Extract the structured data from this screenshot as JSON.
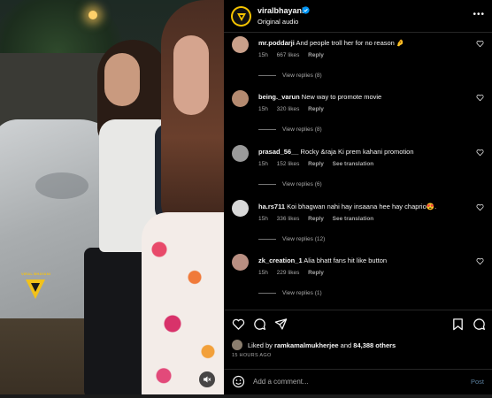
{
  "header": {
    "username": "viralbhayani",
    "audio": "Original audio",
    "brand_color": "#f5c400"
  },
  "media": {
    "watermark_text": "VIRAL BHAYANI"
  },
  "comments": [
    {
      "user": "mr.poddarji",
      "text": "And people troll her for no reason 🤌",
      "time": "15h",
      "likes": "667 likes",
      "reply": "Reply",
      "translate": "",
      "view_replies": "View replies (8)",
      "avatar_color": "#c9a08a"
    },
    {
      "user": "being._varun",
      "text": "New way to promote movie",
      "time": "15h",
      "likes": "320 likes",
      "reply": "Reply",
      "translate": "",
      "view_replies": "View replies (8)",
      "avatar_color": "#b48a70"
    },
    {
      "user": "prasad_56__",
      "text": "Rocky &raja Ki prem kahani promotion",
      "time": "15h",
      "likes": "152 likes",
      "reply": "Reply",
      "translate": "See translation",
      "view_replies": "View replies (6)",
      "avatar_color": "#9a9a9a"
    },
    {
      "user": "ha.rs711",
      "text": "Koi bhagwan nahi hay insaana hee hay chaprio😍.",
      "time": "15h",
      "likes": "336 likes",
      "reply": "Reply",
      "translate": "See translation",
      "view_replies": "View replies (12)",
      "avatar_color": "#d8d8d8"
    },
    {
      "user": "zk_creation_1",
      "text": "Alia bhatt fans hit like button",
      "time": "15h",
      "likes": "229 likes",
      "reply": "Reply",
      "translate": "",
      "view_replies": "View replies (1)",
      "avatar_color": "#b98f82"
    }
  ],
  "likes": {
    "prefix": "Liked by",
    "user": "ramkamalmukherjee",
    "joiner": "and",
    "others": "84,388 others"
  },
  "timestamp": "15 HOURS AGO",
  "comment_box": {
    "placeholder": "Add a comment...",
    "post_label": "Post"
  }
}
